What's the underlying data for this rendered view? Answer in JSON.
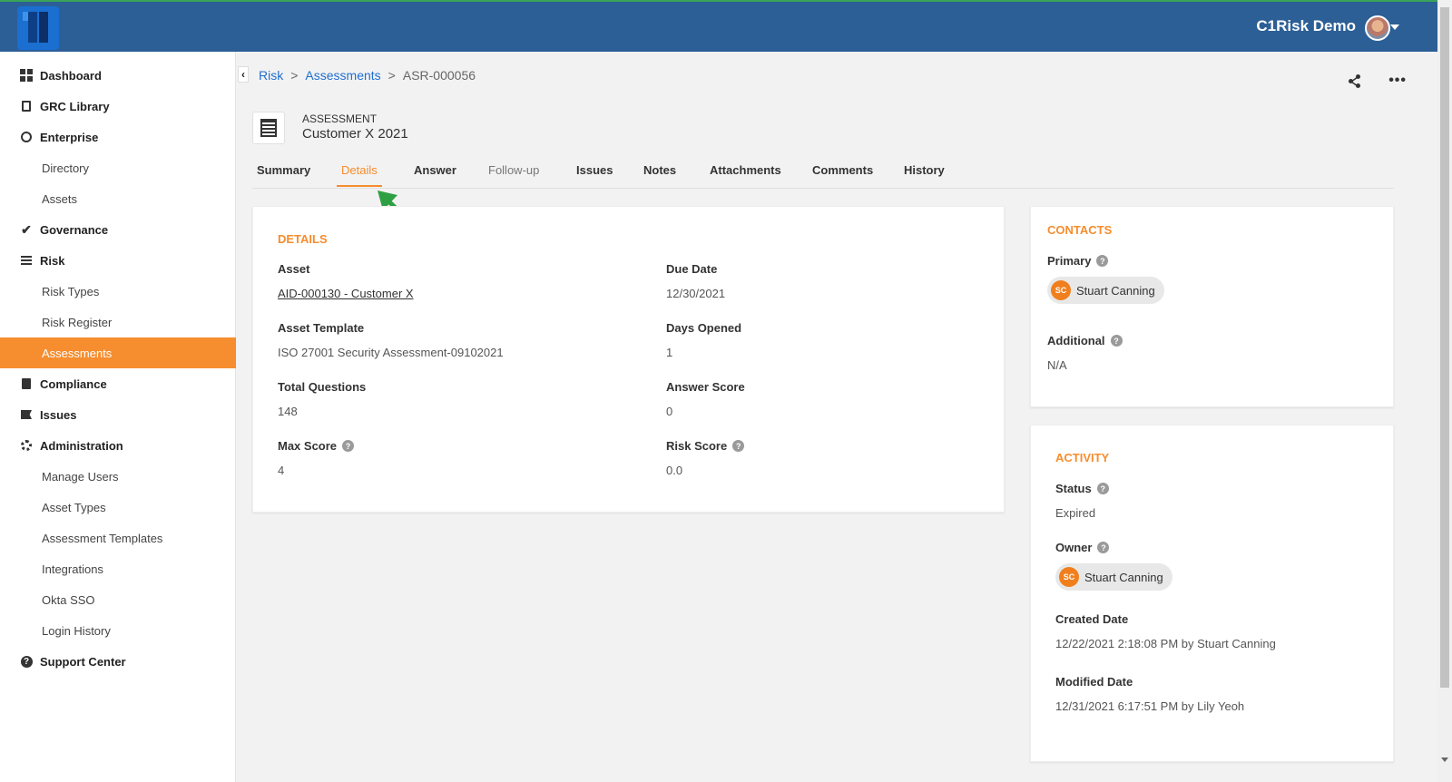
{
  "header": {
    "app_title": "C1Risk Demo"
  },
  "sidebar": {
    "items": [
      {
        "label": "Dashboard"
      },
      {
        "label": "GRC Library"
      },
      {
        "label": "Enterprise"
      },
      {
        "label": "Directory"
      },
      {
        "label": "Assets"
      },
      {
        "label": "Governance"
      },
      {
        "label": "Risk"
      },
      {
        "label": "Risk Types"
      },
      {
        "label": "Risk Register"
      },
      {
        "label": "Assessments"
      },
      {
        "label": "Compliance"
      },
      {
        "label": "Issues"
      },
      {
        "label": "Administration"
      },
      {
        "label": "Manage Users"
      },
      {
        "label": "Asset Types"
      },
      {
        "label": "Assessment Templates"
      },
      {
        "label": "Integrations"
      },
      {
        "label": "Okta SSO"
      },
      {
        "label": "Login History"
      },
      {
        "label": "Support Center"
      }
    ]
  },
  "breadcrumb": {
    "root": "Risk",
    "parent": "Assessments",
    "current": "ASR-000056",
    "sep": ">"
  },
  "record": {
    "type": "ASSESSMENT",
    "name": "Customer X 2021"
  },
  "tabs": [
    "Summary",
    "Details",
    "Answer",
    "Follow-up",
    "Issues",
    "Notes",
    "Attachments",
    "Comments",
    "History"
  ],
  "details": {
    "title": "DETAILS",
    "asset_label": "Asset",
    "asset_value": "AID-000130 - Customer X",
    "due_label": "Due Date",
    "due_value": "12/30/2021",
    "template_label": "Asset Template",
    "template_value": "ISO 27001 Security Assessment-09102021",
    "days_label": "Days Opened",
    "days_value": "1",
    "questions_label": "Total Questions",
    "questions_value": "148",
    "answer_label": "Answer Score",
    "answer_value": "0",
    "max_label": "Max Score",
    "max_value": "4",
    "risk_label": "Risk Score",
    "risk_value": "0.0"
  },
  "contacts": {
    "title": "CONTACTS",
    "primary_label": "Primary",
    "primary_initials": "SC",
    "primary_name": "Stuart Canning",
    "additional_label": "Additional",
    "additional_value": "N/A"
  },
  "activity": {
    "title": "ACTIVITY",
    "status_label": "Status",
    "status_value": "Expired",
    "owner_label": "Owner",
    "owner_initials": "SC",
    "owner_name": "Stuart Canning",
    "created_label": "Created Date",
    "created_value": "12/22/2021 2:18:08 PM by Stuart Canning",
    "modified_label": "Modified Date",
    "modified_value": "12/31/2021 6:17:51 PM by Lily Yeoh"
  },
  "help_glyph": "?",
  "back_glyph": "‹",
  "more_glyph": "•••",
  "colors": {
    "header": "#2c5f96",
    "accent": "#f68d2e",
    "link": "#1f6fd0",
    "annotation_arrow": "#2ea043"
  }
}
